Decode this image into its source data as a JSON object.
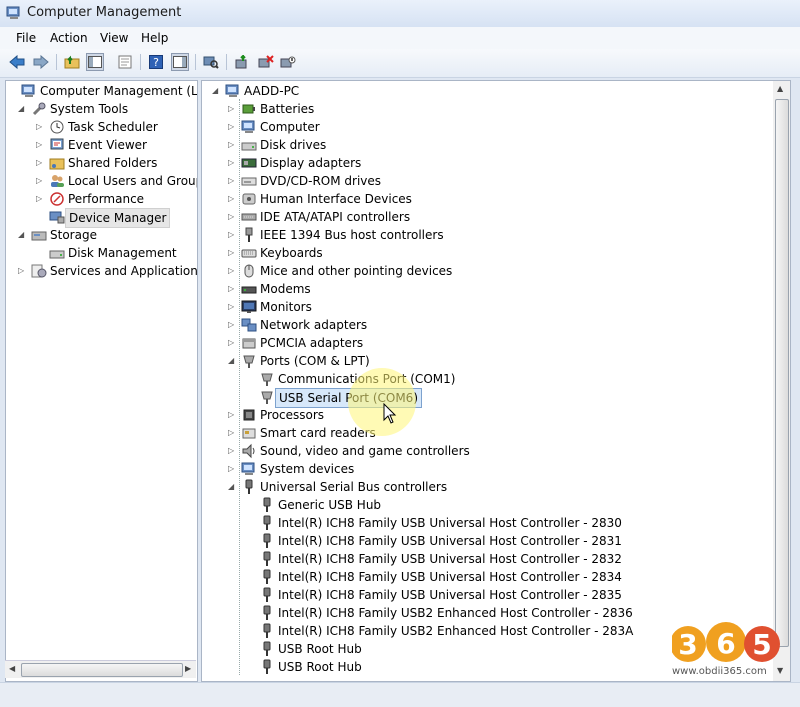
{
  "window": {
    "title": "Computer Management"
  },
  "menu": [
    "File",
    "Action",
    "View",
    "Help"
  ],
  "toolbar_icons": [
    "back-icon",
    "forward-icon",
    "up-folder-icon",
    "show-hide-tree-icon",
    "properties-icon",
    "help-icon",
    "show-hide-action-pane-icon",
    "scan-hardware-icon",
    "update-driver-icon",
    "uninstall-icon",
    "disable-icon"
  ],
  "left_tree": [
    {
      "label": "Computer Management (Local",
      "level": 0,
      "expander": "",
      "icon": "computer-management-icon"
    },
    {
      "label": "System Tools",
      "level": 1,
      "expander": "open",
      "icon": "tools-icon"
    },
    {
      "label": "Task Scheduler",
      "level": 2,
      "expander": "closed",
      "icon": "clock-icon"
    },
    {
      "label": "Event Viewer",
      "level": 2,
      "expander": "closed",
      "icon": "event-viewer-icon"
    },
    {
      "label": "Shared Folders",
      "level": 2,
      "expander": "closed",
      "icon": "shared-folder-icon"
    },
    {
      "label": "Local Users and Groups",
      "level": 2,
      "expander": "closed",
      "icon": "users-icon"
    },
    {
      "label": "Performance",
      "level": 2,
      "expander": "closed",
      "icon": "performance-icon"
    },
    {
      "label": "Device Manager",
      "level": 2,
      "expander": "",
      "icon": "device-manager-icon",
      "selected": true
    },
    {
      "label": "Storage",
      "level": 1,
      "expander": "open",
      "icon": "storage-icon"
    },
    {
      "label": "Disk Management",
      "level": 2,
      "expander": "",
      "icon": "disk-icon"
    },
    {
      "label": "Services and Applications",
      "level": 1,
      "expander": "closed",
      "icon": "services-icon"
    }
  ],
  "device_tree": {
    "root": "AADD-PC",
    "items": [
      {
        "label": "Batteries",
        "level": 1,
        "expander": "closed",
        "icon": "battery-icon"
      },
      {
        "label": "Computer",
        "level": 1,
        "expander": "closed",
        "icon": "computer-icon"
      },
      {
        "label": "Disk drives",
        "level": 1,
        "expander": "closed",
        "icon": "disk-drive-icon"
      },
      {
        "label": "Display adapters",
        "level": 1,
        "expander": "closed",
        "icon": "display-adapter-icon"
      },
      {
        "label": "DVD/CD-ROM drives",
        "level": 1,
        "expander": "closed",
        "icon": "dvd-icon"
      },
      {
        "label": "Human Interface Devices",
        "level": 1,
        "expander": "closed",
        "icon": "hid-icon"
      },
      {
        "label": "IDE ATA/ATAPI controllers",
        "level": 1,
        "expander": "closed",
        "icon": "ide-icon"
      },
      {
        "label": "IEEE 1394 Bus host controllers",
        "level": 1,
        "expander": "closed",
        "icon": "firewire-icon"
      },
      {
        "label": "Keyboards",
        "level": 1,
        "expander": "closed",
        "icon": "keyboard-icon"
      },
      {
        "label": "Mice and other pointing devices",
        "level": 1,
        "expander": "closed",
        "icon": "mouse-icon"
      },
      {
        "label": "Modems",
        "level": 1,
        "expander": "closed",
        "icon": "modem-icon"
      },
      {
        "label": "Monitors",
        "level": 1,
        "expander": "closed",
        "icon": "monitor-icon"
      },
      {
        "label": "Network adapters",
        "level": 1,
        "expander": "closed",
        "icon": "network-icon"
      },
      {
        "label": "PCMCIA adapters",
        "level": 1,
        "expander": "closed",
        "icon": "pcmcia-icon"
      },
      {
        "label": "Ports (COM & LPT)",
        "level": 1,
        "expander": "open",
        "icon": "port-icon"
      },
      {
        "label": "Communications Port (COM1)",
        "level": 2,
        "expander": "",
        "icon": "port-icon"
      },
      {
        "label": "USB Serial Port (COM6)",
        "level": 2,
        "expander": "",
        "icon": "port-icon",
        "selected": true
      },
      {
        "label": "Processors",
        "level": 1,
        "expander": "closed",
        "icon": "processor-icon"
      },
      {
        "label": "Smart card readers",
        "level": 1,
        "expander": "closed",
        "icon": "smart-card-icon"
      },
      {
        "label": "Sound, video and game controllers",
        "level": 1,
        "expander": "closed",
        "icon": "sound-icon"
      },
      {
        "label": "System devices",
        "level": 1,
        "expander": "closed",
        "icon": "system-devices-icon"
      },
      {
        "label": "Universal Serial Bus controllers",
        "level": 1,
        "expander": "open",
        "icon": "usb-icon"
      },
      {
        "label": "Generic USB Hub",
        "level": 2,
        "expander": "",
        "icon": "usb-icon"
      },
      {
        "label": "Intel(R) ICH8 Family USB Universal Host Controller - 2830",
        "level": 2,
        "expander": "",
        "icon": "usb-icon"
      },
      {
        "label": "Intel(R) ICH8 Family USB Universal Host Controller - 2831",
        "level": 2,
        "expander": "",
        "icon": "usb-icon"
      },
      {
        "label": "Intel(R) ICH8 Family USB Universal Host Controller - 2832",
        "level": 2,
        "expander": "",
        "icon": "usb-icon"
      },
      {
        "label": "Intel(R) ICH8 Family USB Universal Host Controller - 2834",
        "level": 2,
        "expander": "",
        "icon": "usb-icon"
      },
      {
        "label": "Intel(R) ICH8 Family USB Universal Host Controller - 2835",
        "level": 2,
        "expander": "",
        "icon": "usb-icon"
      },
      {
        "label": "Intel(R) ICH8 Family USB2 Enhanced Host Controller - 2836",
        "level": 2,
        "expander": "",
        "icon": "usb-icon"
      },
      {
        "label": "Intel(R) ICH8 Family USB2 Enhanced Host Controller - 283A",
        "level": 2,
        "expander": "",
        "icon": "usb-icon"
      },
      {
        "label": "USB Root Hub",
        "level": 2,
        "expander": "",
        "icon": "usb-icon"
      },
      {
        "label": "USB Root Hub",
        "level": 2,
        "expander": "",
        "icon": "usb-icon"
      }
    ]
  },
  "watermark": {
    "logo_text": "365",
    "url": "www.obdii365.com"
  },
  "colors": {
    "selection": "#d7e8fa",
    "selection_border": "#7da2ce",
    "highlight": "#fff578",
    "logo": "#f0a020"
  }
}
